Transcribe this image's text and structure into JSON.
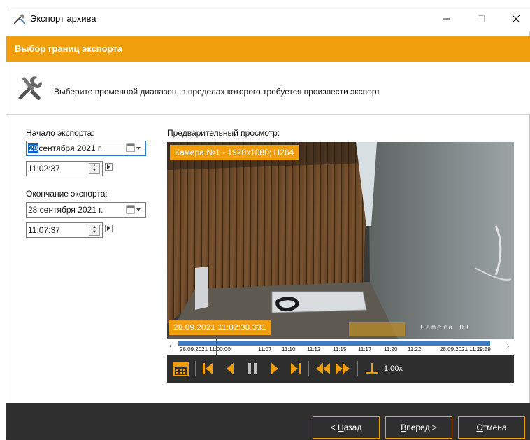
{
  "window": {
    "title": "Экспорт архива",
    "step_title": "Выбор границ экспорта",
    "description": "Выберите временной диапазон, в пределах которого требуется произвести экспорт"
  },
  "start": {
    "label": "Начало экспорта:",
    "date_day": "28",
    "date_rest": " сентября 2021 г.",
    "time": "11:02:37"
  },
  "end": {
    "label": "Окончание экспорта:",
    "date": "28 сентября 2021 г.",
    "time": "11:07:37"
  },
  "preview": {
    "label": "Предварительный просмотр:",
    "camera_badge": "Камера №1 - 1920x1080; H264",
    "timestamp": "28.09.2021 11:02:38.331",
    "osd_text": "Camera 01",
    "timeline": {
      "start_label": "28.09.2021 11:00:00",
      "ticks": [
        "11:07",
        "11:10",
        "11:12",
        "11:15",
        "11:17",
        "11:20",
        "11:22"
      ],
      "end_label": "28.09.2021 11:29:59"
    },
    "speed": "1,00x"
  },
  "buttons": {
    "back_prefix": "< ",
    "back_key": "Н",
    "back_rest": "азад",
    "next_key": "В",
    "next_rest": "перед >",
    "cancel_key": "О",
    "cancel_rest": "тмена"
  },
  "colors": {
    "accent": "#f19e0c",
    "footer": "#2f2f2f",
    "timeline_bar": "#3d7bc4"
  }
}
